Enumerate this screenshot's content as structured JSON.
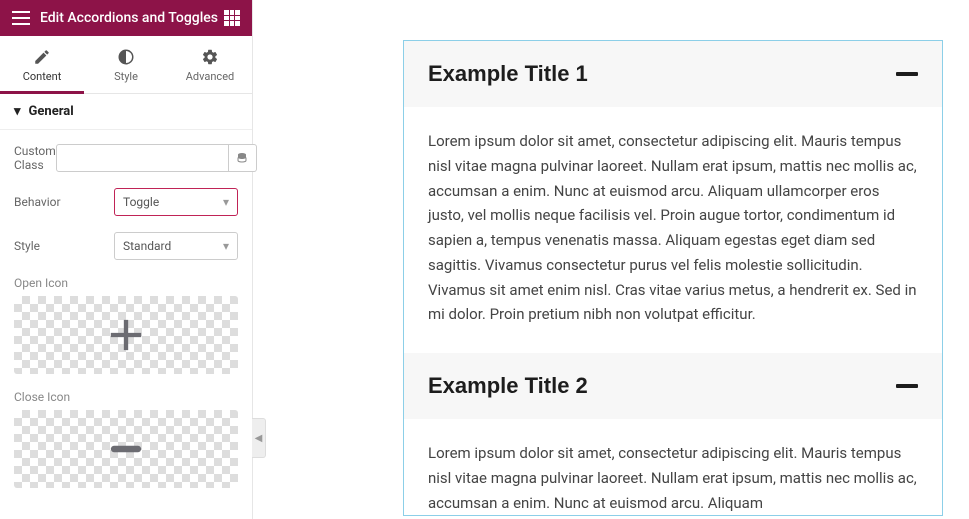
{
  "header": {
    "title": "Edit Accordions and Toggles"
  },
  "tabs": {
    "content": "Content",
    "style": "Style",
    "advanced": "Advanced"
  },
  "section": {
    "general": "General"
  },
  "controls": {
    "customClass": {
      "label": "Custom Class",
      "value": ""
    },
    "behavior": {
      "label": "Behavior",
      "value": "Toggle"
    },
    "style": {
      "label": "Style",
      "value": "Standard"
    },
    "openIcon": {
      "label": "Open Icon"
    },
    "closeIcon": {
      "label": "Close Icon"
    }
  },
  "preview": {
    "items": [
      {
        "title": "Example Title 1",
        "body": "Lorem ipsum dolor sit amet, consectetur adipiscing elit. Mauris tempus nisl vitae magna pulvinar laoreet. Nullam erat ipsum, mattis nec mollis ac, accumsan a enim. Nunc at euismod arcu. Aliquam ullamcorper eros justo, vel mollis neque facilisis vel. Proin augue tortor, condimentum id sapien a, tempus venenatis massa. Aliquam egestas eget diam sed sagittis. Vivamus consectetur purus vel felis molestie sollicitudin. Vivamus sit amet enim nisl. Cras vitae varius metus, a hendrerit ex. Sed in mi dolor. Proin pretium nibh non volutpat efficitur."
      },
      {
        "title": "Example Title 2",
        "body": "Lorem ipsum dolor sit amet, consectetur adipiscing elit. Mauris tempus nisl vitae magna pulvinar laoreet. Nullam erat ipsum, mattis nec mollis ac, accumsan a enim. Nunc at euismod arcu. Aliquam"
      }
    ]
  }
}
